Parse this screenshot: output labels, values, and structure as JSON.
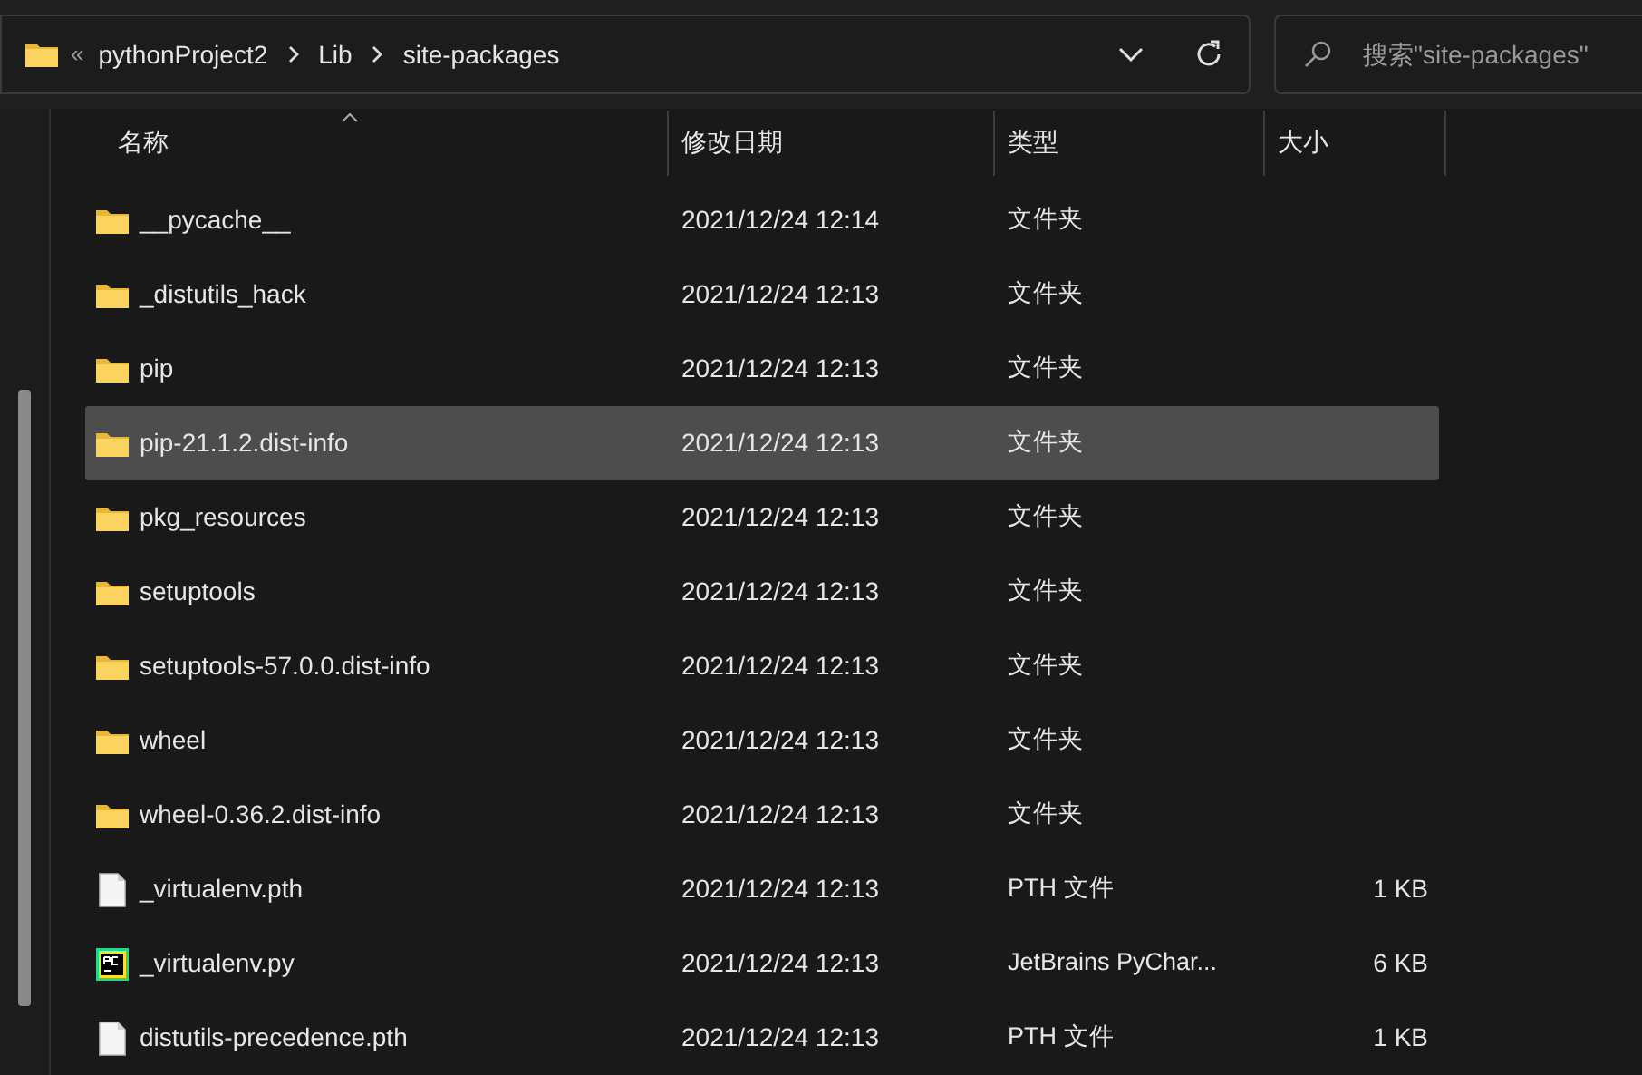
{
  "address_bar": {
    "overflow": "«",
    "crumbs": [
      "pythonProject2",
      "Lib",
      "site-packages"
    ]
  },
  "search": {
    "placeholder": "搜索\"site-packages\""
  },
  "columns": [
    {
      "label": "名称",
      "sorted": true
    },
    {
      "label": "修改日期",
      "sorted": false
    },
    {
      "label": "类型",
      "sorted": false
    },
    {
      "label": "大小",
      "sorted": false
    }
  ],
  "rows": [
    {
      "kind": "folder",
      "name": "__pycache__",
      "date": "2021/12/24 12:14",
      "type": "文件夹",
      "selected": false
    },
    {
      "kind": "folder",
      "name": "_distutils_hack",
      "date": "2021/12/24 12:13",
      "type": "文件夹",
      "selected": false
    },
    {
      "kind": "folder",
      "name": "pip",
      "date": "2021/12/24 12:13",
      "type": "文件夹",
      "selected": false
    },
    {
      "kind": "folder",
      "name": "pip-21.1.2.dist-info",
      "date": "2021/12/24 12:13",
      "type": "文件夹",
      "selected": true
    },
    {
      "kind": "folder",
      "name": "pkg_resources",
      "date": "2021/12/24 12:13",
      "type": "文件夹",
      "selected": false
    },
    {
      "kind": "folder",
      "name": "setuptools",
      "date": "2021/12/24 12:13",
      "type": "文件夹",
      "selected": false
    },
    {
      "kind": "folder",
      "name": "setuptools-57.0.0.dist-info",
      "date": "2021/12/24 12:13",
      "type": "文件夹",
      "selected": false
    },
    {
      "kind": "folder",
      "name": "wheel",
      "date": "2021/12/24 12:13",
      "type": "文件夹",
      "selected": false
    },
    {
      "kind": "folder",
      "name": "wheel-0.36.2.dist-info",
      "date": "2021/12/24 12:13",
      "type": "文件夹",
      "selected": false
    },
    {
      "kind": "file",
      "name": "_virtualenv.pth",
      "date": "2021/12/24 12:13",
      "type": "PTH 文件",
      "size": "1 KB",
      "selected": false
    },
    {
      "kind": "pycharm",
      "name": "_virtualenv.py",
      "date": "2021/12/24 12:13",
      "type": "JetBrains PyChar...",
      "size": "6 KB",
      "selected": false
    },
    {
      "kind": "file",
      "name": "distutils-precedence.pth",
      "date": "2021/12/24 12:13",
      "type": "PTH 文件",
      "size": "1 KB",
      "selected": false
    }
  ]
}
